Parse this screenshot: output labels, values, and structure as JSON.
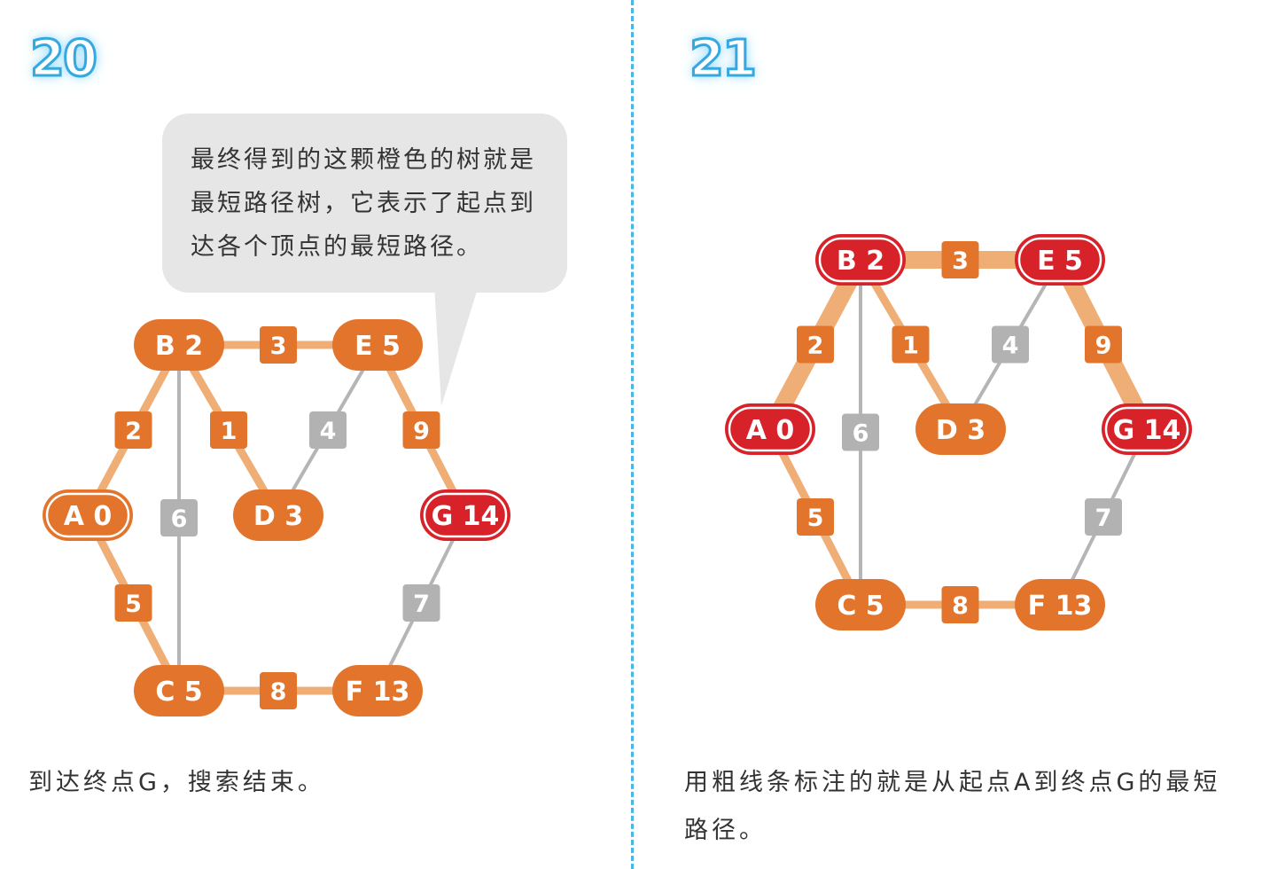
{
  "left_panel": {
    "step_number": "20",
    "bubble_text": "最终得到的这颗橙色的树就是最短路径树，它表示了起点到达各个顶点的最短路径。",
    "caption": "到达终点G，搜索结束。",
    "nodes": [
      {
        "id": "A",
        "label": "A 0",
        "style": "orange-ring"
      },
      {
        "id": "B",
        "label": "B 2",
        "style": "orange"
      },
      {
        "id": "C",
        "label": "C 5",
        "style": "orange"
      },
      {
        "id": "D",
        "label": "D 3",
        "style": "orange"
      },
      {
        "id": "E",
        "label": "E 5",
        "style": "orange"
      },
      {
        "id": "F",
        "label": "F 13",
        "style": "orange"
      },
      {
        "id": "G",
        "label": "G 14",
        "style": "red-ring"
      }
    ],
    "edges": [
      {
        "from": "A",
        "to": "B",
        "weight": "2",
        "status": "tree"
      },
      {
        "from": "A",
        "to": "C",
        "weight": "5",
        "status": "tree"
      },
      {
        "from": "B",
        "to": "C",
        "weight": "6",
        "status": "gray"
      },
      {
        "from": "B",
        "to": "D",
        "weight": "1",
        "status": "tree"
      },
      {
        "from": "B",
        "to": "E",
        "weight": "3",
        "status": "tree"
      },
      {
        "from": "C",
        "to": "F",
        "weight": "8",
        "status": "tree"
      },
      {
        "from": "D",
        "to": "E",
        "weight": "4",
        "status": "gray"
      },
      {
        "from": "E",
        "to": "G",
        "weight": "9",
        "status": "tree"
      },
      {
        "from": "F",
        "to": "G",
        "weight": "7",
        "status": "gray"
      }
    ]
  },
  "right_panel": {
    "step_number": "21",
    "caption": "用粗线条标注的就是从起点A到终点G的最短路径。",
    "nodes": [
      {
        "id": "A",
        "label": "A 0",
        "style": "red-ring"
      },
      {
        "id": "B",
        "label": "B 2",
        "style": "red-ring"
      },
      {
        "id": "C",
        "label": "C 5",
        "style": "orange"
      },
      {
        "id": "D",
        "label": "D 3",
        "style": "orange"
      },
      {
        "id": "E",
        "label": "E 5",
        "style": "red-ring"
      },
      {
        "id": "F",
        "label": "F 13",
        "style": "orange"
      },
      {
        "id": "G",
        "label": "G 14",
        "style": "red-ring"
      }
    ],
    "edges": [
      {
        "from": "A",
        "to": "B",
        "weight": "2",
        "status": "path"
      },
      {
        "from": "A",
        "to": "C",
        "weight": "5",
        "status": "tree"
      },
      {
        "from": "B",
        "to": "C",
        "weight": "6",
        "status": "gray"
      },
      {
        "from": "B",
        "to": "D",
        "weight": "1",
        "status": "tree"
      },
      {
        "from": "B",
        "to": "E",
        "weight": "3",
        "status": "path"
      },
      {
        "from": "C",
        "to": "F",
        "weight": "8",
        "status": "tree"
      },
      {
        "from": "D",
        "to": "E",
        "weight": "4",
        "status": "gray"
      },
      {
        "from": "E",
        "to": "G",
        "weight": "9",
        "status": "path"
      },
      {
        "from": "F",
        "to": "G",
        "weight": "7",
        "status": "gray"
      }
    ]
  },
  "colors": {
    "node_orange": "#e2752b",
    "node_red": "#d8222a",
    "tree_edge": "#f0ae77",
    "gray_edge": "#b5b5b5",
    "weight_orange": "#e2752b",
    "weight_gray": "#b2b2b2",
    "accent_blue": "#35a8e0"
  }
}
